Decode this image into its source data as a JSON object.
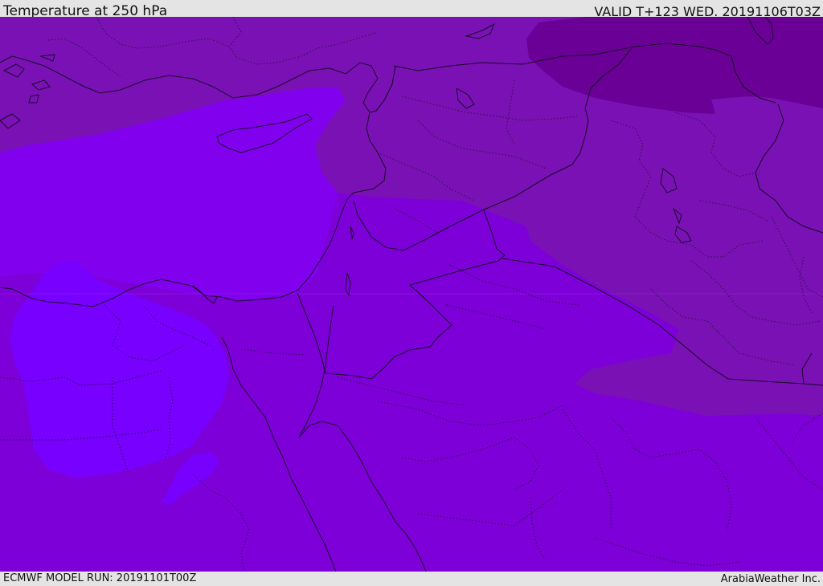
{
  "header": {
    "title": "Temperature at 250 hPa",
    "valid": "VALID T+123 WED. 20191106T03Z"
  },
  "footer": {
    "model_run": "ECMWF MODEL RUN: 20191101T00Z",
    "credit": "ArabiaWeather Inc."
  },
  "colors": {
    "background": "#7d00d9",
    "warmer_zone": "#7a11b5",
    "warmest_zone": "#6a0096",
    "cold_zone": "#8100ee",
    "coldest_zone": "#7700ff",
    "coastline": "#1a0a2a"
  }
}
